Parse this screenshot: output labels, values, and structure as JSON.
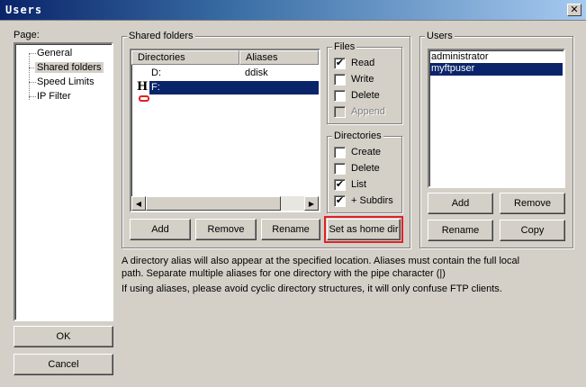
{
  "window": {
    "title": "Users",
    "close_glyph": "✕"
  },
  "page_panel": {
    "label": "Page:",
    "items": [
      {
        "label": "General",
        "selected": false
      },
      {
        "label": "Shared folders",
        "selected": true
      },
      {
        "label": "Speed Limits",
        "selected": false
      },
      {
        "label": "IP Filter",
        "selected": false
      }
    ]
  },
  "shared_folders": {
    "legend": "Shared folders",
    "columns": [
      "Directories",
      "Aliases"
    ],
    "rows": [
      {
        "directory": "D:",
        "alias": "ddisk",
        "home": false,
        "selected": false
      },
      {
        "directory": "F:",
        "alias": "",
        "home": true,
        "selected": true
      }
    ],
    "home_marker": "H",
    "buttons": {
      "add": "Add",
      "remove": "Remove",
      "rename": "Rename",
      "set_home": "Set as home dir"
    }
  },
  "files": {
    "legend": "Files",
    "options": [
      {
        "label": "Read",
        "checked": true,
        "disabled": false
      },
      {
        "label": "Write",
        "checked": false,
        "disabled": false
      },
      {
        "label": "Delete",
        "checked": false,
        "disabled": false
      },
      {
        "label": "Append",
        "checked": false,
        "disabled": true
      }
    ]
  },
  "directories": {
    "legend": "Directories",
    "options": [
      {
        "label": "Create",
        "checked": false
      },
      {
        "label": "Delete",
        "checked": false
      },
      {
        "label": "List",
        "checked": true
      },
      {
        "label": "+ Subdirs",
        "checked": true
      }
    ]
  },
  "users": {
    "legend": "Users",
    "items": [
      {
        "name": "administrator",
        "selected": false
      },
      {
        "name": "myftpuser",
        "selected": true
      }
    ],
    "buttons": {
      "add": "Add",
      "remove": "Remove",
      "rename": "Rename",
      "copy": "Copy"
    }
  },
  "notes": {
    "line1": "A directory alias will also appear at the specified location. Aliases must contain the full local",
    "line2": "path. Separate multiple aliases for one directory with the pipe character (|)",
    "line3": "If using aliases, please avoid cyclic directory structures, it will only confuse FTP clients."
  },
  "dialog_buttons": {
    "ok": "OK",
    "cancel": "Cancel"
  },
  "check_glyph": "✔",
  "colors": {
    "highlight_outline": "#e0202a",
    "selection": "#0a246a"
  }
}
